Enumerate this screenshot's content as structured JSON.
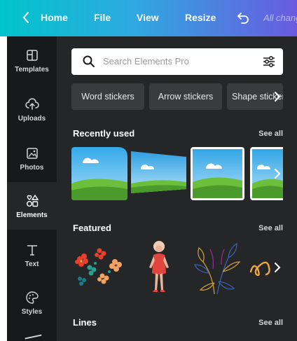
{
  "topbar": {
    "home": "Home",
    "file": "File",
    "view": "View",
    "resize": "Resize",
    "saved": "All changes saved"
  },
  "rail": {
    "items": [
      {
        "label": "Templates",
        "icon": "templates-icon"
      },
      {
        "label": "Uploads",
        "icon": "upload-cloud-icon"
      },
      {
        "label": "Photos",
        "icon": "photo-icon"
      },
      {
        "label": "Elements",
        "icon": "elements-icon",
        "active": true
      },
      {
        "label": "Text",
        "icon": "text-icon"
      },
      {
        "label": "Styles",
        "icon": "palette-icon"
      }
    ]
  },
  "panel": {
    "search_placeholder": "Search Elements Pro",
    "chips": [
      "Word stickers",
      "Arrow stickers",
      "Shape stickers"
    ],
    "recently_used": {
      "title": "Recently used",
      "see_all": "See all"
    },
    "featured": {
      "title": "Featured",
      "see_all": "See all"
    },
    "lines": {
      "title": "Lines",
      "see_all": "See all"
    }
  },
  "colors": {
    "topbar_start": "#00c4cc",
    "topbar_end": "#6a5ae0",
    "rail_bg": "#18191b",
    "panel_bg": "#252627",
    "chip_bg": "#3a3b3e"
  }
}
